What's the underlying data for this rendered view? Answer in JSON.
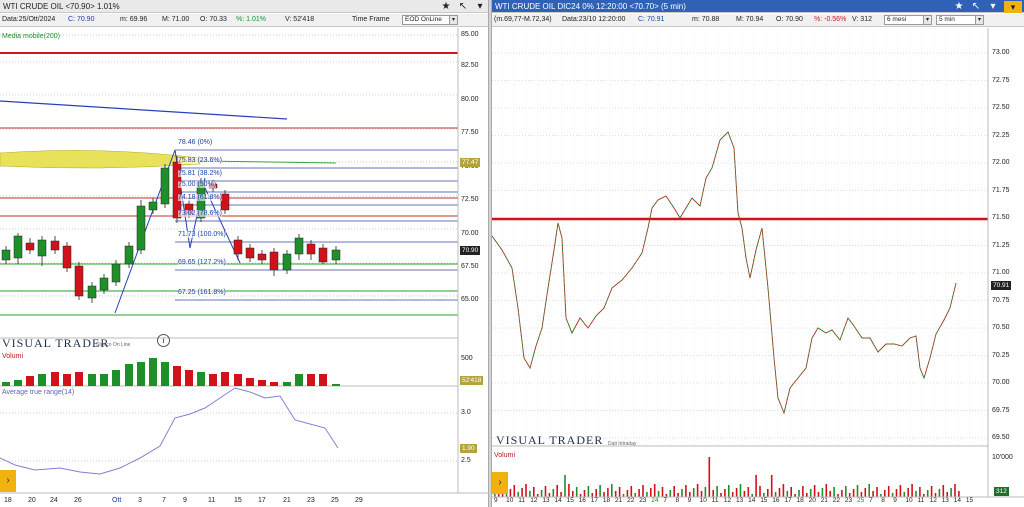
{
  "left": {
    "title": "WTI CRUDE OIL <70.90> 1.01%",
    "info": {
      "data": "Data:25/Ott/2024",
      "close": "C: 70.90",
      "min": "m: 69.96",
      "max": "M: 71.00",
      "open": "O: 70.33",
      "pct": "%: 1.01%",
      "volume": "V: 52'418",
      "timeframe_label": "Time Frame",
      "timeframe_value": "EOD OnLine"
    },
    "indicator_label": "Media mobile(200)",
    "fib_labels": [
      "78.46 (0%)",
      "75.83 (23.6%)",
      "75.81 (38.2%)",
      "75.00 (50%)",
      "74.18 (61.8%)",
      "73.02 (78.6%)",
      "71.73 (100.0%)",
      "69.65 (127.2%)",
      "67.25 (161.8%)"
    ],
    "price_ticks": [
      "85.00",
      "82.50",
      "80.00",
      "77.50",
      "75.00",
      "72.50",
      "70.00",
      "67.50",
      "65.00"
    ],
    "price_badges": [
      "77.47",
      "70.90"
    ],
    "logo": "VISUAL TRADER",
    "logo_sub": "Storico On Line",
    "volume_label": "Volumi",
    "volume_tick": "500",
    "volume_badge": "52'418",
    "atr_label": "Average true range(14)",
    "atr_ticks": [
      "3.0",
      "2.5"
    ],
    "atr_badge": "1.90",
    "x_ticks": [
      "18",
      "20",
      "24",
      "26",
      "Ott",
      "3",
      "7",
      "9",
      "11",
      "15",
      "17",
      "21",
      "23",
      "25",
      "29"
    ]
  },
  "right": {
    "title": "WTI CRUDE OIL DIC24 0% 12:20:00 <70.70> (5 min)",
    "info": {
      "range": "(m.69,77-M.72,34)",
      "data": "Data:23/10 12:20:00",
      "close": "C: 70.91",
      "min": "m: 70.88",
      "max": "M: 70.94",
      "open": "O: 70.90",
      "pct": "%: -0.56%",
      "volume": "V: 312",
      "period": "6 mesi",
      "interval": "5 min"
    },
    "price_ticks": [
      "73.00",
      "72.75",
      "72.50",
      "72.25",
      "72.00",
      "71.75",
      "71.50",
      "71.25",
      "71.00",
      "70.75",
      "70.50",
      "70.25",
      "70.00",
      "69.75",
      "69.50"
    ],
    "price_badge": "70.91",
    "logo": "VISUAL TRADER",
    "logo_sub": "Dati Intraday",
    "volume_label": "Volumi",
    "volume_tick": "10'000",
    "volume_badge": "312",
    "x_ticks": [
      "9",
      "10",
      "11",
      "12",
      "13",
      "14",
      "15",
      "16",
      "17",
      "18",
      "21",
      "22",
      "23",
      "24",
      "7",
      "8",
      "9",
      "10",
      "11",
      "12",
      "13",
      "14",
      "15",
      "16",
      "17",
      "18",
      "20",
      "21",
      "22",
      "23",
      "25",
      "7",
      "8",
      "9",
      "10",
      "11",
      "12",
      "13",
      "14",
      "15"
    ]
  },
  "colors": {
    "up": "#1f8f2a",
    "down": "#d1121a",
    "resistance": "#d1121a",
    "fib": "#3340a8",
    "accent": "#f1b10f"
  },
  "icons": [
    "star-icon",
    "draw-tool-icon",
    "dropdown-icon",
    "close-icon"
  ]
}
